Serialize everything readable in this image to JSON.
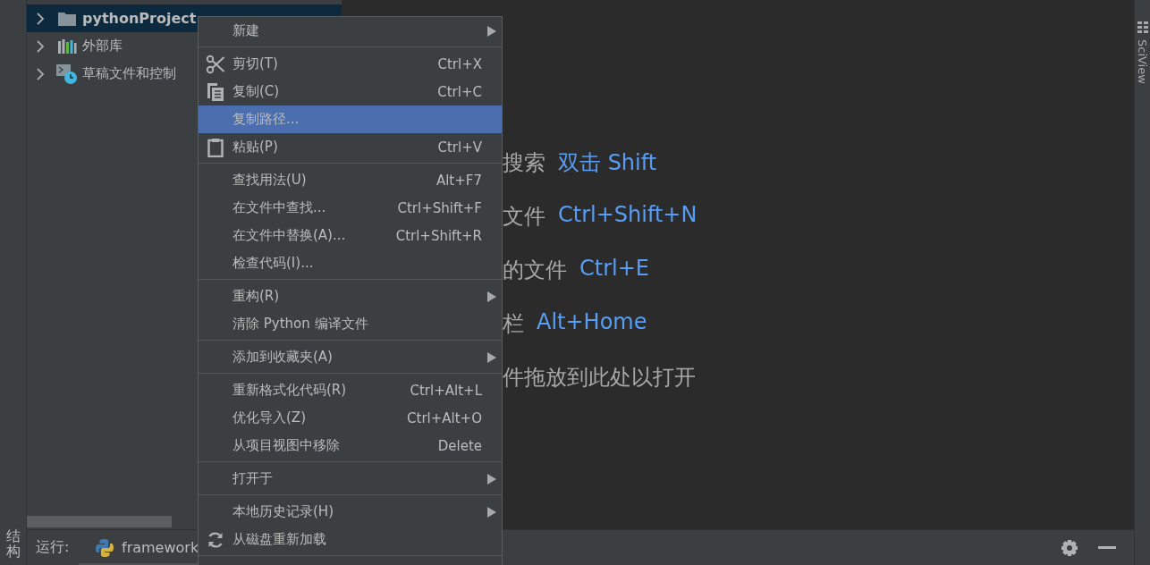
{
  "left_strip": {
    "label": "结构"
  },
  "project_tree": {
    "items": [
      {
        "label": "pythonProject",
        "kind": "folder",
        "selected": true
      },
      {
        "label": "外部库",
        "kind": "library",
        "selected": false
      },
      {
        "label": "草稿文件和控制",
        "kind": "scratch",
        "selected": false
      }
    ]
  },
  "editor_hints": [
    {
      "action": "搜索",
      "shortcut": "双击 Shift"
    },
    {
      "action": "文件",
      "shortcut": "Ctrl+Shift+N"
    },
    {
      "action": "的文件",
      "shortcut": "Ctrl+E"
    },
    {
      "action": "栏",
      "shortcut": "Alt+Home"
    },
    {
      "action": "件拖放到此处以打开"
    }
  ],
  "right_strip": {
    "label": "SciView"
  },
  "run_bar": {
    "label": "运行:",
    "tab": "framework"
  },
  "menu": {
    "items": [
      {
        "kind": "item",
        "label": "新建",
        "submenu": true,
        "selected": false
      },
      {
        "kind": "separator"
      },
      {
        "kind": "item",
        "label": "剪切(T)",
        "shortcut": "Ctrl+X",
        "submenu": false,
        "selected": false
      },
      {
        "kind": "item",
        "label": "复制(C)",
        "shortcut": "Ctrl+C",
        "submenu": false,
        "selected": false
      },
      {
        "kind": "item",
        "label": "复制路径...",
        "submenu": false,
        "selected": true
      },
      {
        "kind": "item",
        "label": "粘贴(P)",
        "shortcut": "Ctrl+V",
        "submenu": false,
        "selected": false
      },
      {
        "kind": "separator"
      },
      {
        "kind": "item",
        "label": "查找用法(U)",
        "shortcut": "Alt+F7",
        "submenu": false,
        "selected": false
      },
      {
        "kind": "item",
        "label": "在文件中查找...",
        "shortcut": "Ctrl+Shift+F",
        "submenu": false,
        "selected": false
      },
      {
        "kind": "item",
        "label": "在文件中替换(A)...",
        "shortcut": "Ctrl+Shift+R",
        "submenu": false,
        "selected": false
      },
      {
        "kind": "item",
        "label": "检查代码(I)...",
        "submenu": false,
        "selected": false
      },
      {
        "kind": "separator"
      },
      {
        "kind": "item",
        "label": "重构(R)",
        "submenu": true,
        "selected": false
      },
      {
        "kind": "item",
        "label": "清除 Python 编译文件",
        "submenu": false,
        "selected": false
      },
      {
        "kind": "separator"
      },
      {
        "kind": "item",
        "label": "添加到收藏夹(A)",
        "submenu": true,
        "selected": false
      },
      {
        "kind": "separator"
      },
      {
        "kind": "item",
        "label": "重新格式化代码(R)",
        "shortcut": "Ctrl+Alt+L",
        "submenu": false,
        "selected": false
      },
      {
        "kind": "item",
        "label": "优化导入(Z)",
        "shortcut": "Ctrl+Alt+O",
        "submenu": false,
        "selected": false
      },
      {
        "kind": "item",
        "label": "从项目视图中移除",
        "shortcut": "Delete",
        "submenu": false,
        "selected": false
      },
      {
        "kind": "separator"
      },
      {
        "kind": "item",
        "label": "打开于",
        "submenu": true,
        "selected": false
      },
      {
        "kind": "separator"
      },
      {
        "kind": "item",
        "label": "本地历史记录(H)",
        "submenu": true,
        "selected": false
      },
      {
        "kind": "item",
        "label": "从磁盘重新加载",
        "submenu": false,
        "selected": false
      },
      {
        "kind": "separator"
      }
    ]
  }
}
